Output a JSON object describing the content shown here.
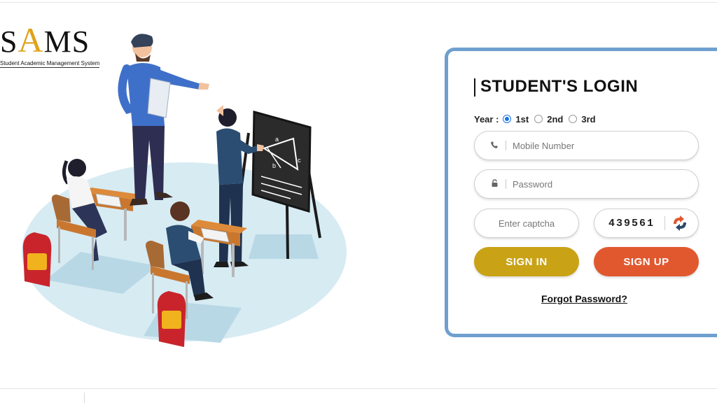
{
  "logo": {
    "word_before": "S",
    "word_accent": "A",
    "word_after": "MS",
    "subtitle": "Student Academic Management System"
  },
  "login": {
    "title": "STUDENT'S LOGIN",
    "year_label": "Year :",
    "year_options": [
      "1st",
      "2nd",
      "3rd"
    ],
    "year_selected": "1st",
    "mobile_placeholder": "Mobile Number",
    "password_placeholder": "Password",
    "captcha_placeholder": "Enter captcha",
    "captcha_code": "439561",
    "signin_label": "SIGN IN",
    "signup_label": "SIGN UP",
    "forgot_label": "Forgot Password?"
  },
  "icons": {
    "mobile": "phone-icon",
    "password": "lock-icon",
    "captcha": "refresh-icon"
  },
  "colors": {
    "card_border": "#6e9fcf",
    "signin": "#c9a216",
    "signup": "#e1582f",
    "logo_accent": "#e0a21b"
  }
}
